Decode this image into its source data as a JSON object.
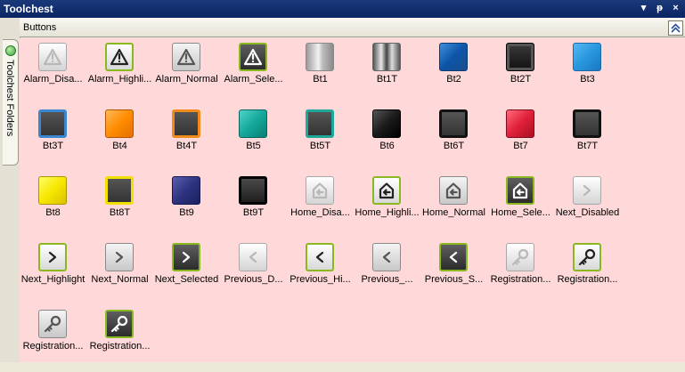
{
  "window": {
    "title": "Toolchest",
    "controls": [
      "▾",
      "ᵽ",
      "×"
    ]
  },
  "side_panel": {
    "label": "Toolchest Folders"
  },
  "section": {
    "title": "Buttons"
  },
  "items": [
    {
      "label": "Alarm_Disa...",
      "style": "gray-light",
      "glyph": "alarm",
      "glyph_color": "#b8b8b8"
    },
    {
      "label": "Alarm_Highli...",
      "style": "hl",
      "glyph": "alarm",
      "glyph_color": "#222222"
    },
    {
      "label": "Alarm_Normal",
      "style": "gray-dark",
      "glyph": "alarm",
      "glyph_color": "#555555"
    },
    {
      "label": "Alarm_Sele...",
      "style": "sel",
      "glyph": "alarm",
      "glyph_color": "#ffffff"
    },
    {
      "label": "Bt1",
      "style": "silver",
      "glyph": "none"
    },
    {
      "label": "Bt1T",
      "style": "tex",
      "glyph": "none"
    },
    {
      "label": "Bt2",
      "style": "blue",
      "glyph": "none"
    },
    {
      "label": "Bt2T",
      "style": "black",
      "glyph": "none"
    },
    {
      "label": "Bt3",
      "style": "lightblue",
      "glyph": "none"
    },
    {
      "label": "Bt3T",
      "style": "blue-t",
      "glyph": "none"
    },
    {
      "label": "Bt4",
      "style": "orange",
      "glyph": "none"
    },
    {
      "label": "Bt4T",
      "style": "orange-t",
      "glyph": "none"
    },
    {
      "label": "Bt5",
      "style": "teal",
      "glyph": "none"
    },
    {
      "label": "Bt5T",
      "style": "teal-t",
      "glyph": "none"
    },
    {
      "label": "Bt6",
      "style": "black2",
      "glyph": "none"
    },
    {
      "label": "Bt6T",
      "style": "black-t",
      "glyph": "none"
    },
    {
      "label": "Bt7",
      "style": "red",
      "glyph": "none"
    },
    {
      "label": "Bt7T",
      "style": "black-t",
      "glyph": "none"
    },
    {
      "label": "Bt8",
      "style": "yellow",
      "glyph": "none"
    },
    {
      "label": "Bt8T",
      "style": "yellow-t",
      "glyph": "none"
    },
    {
      "label": "Bt9",
      "style": "navy",
      "glyph": "none"
    },
    {
      "label": "Bt9T",
      "style": "black9t",
      "glyph": "none"
    },
    {
      "label": "Home_Disa...",
      "style": "gray-light",
      "glyph": "home",
      "glyph_color": "#b8b8b8"
    },
    {
      "label": "Home_Highli...",
      "style": "hl",
      "glyph": "home",
      "glyph_color": "#222222"
    },
    {
      "label": "Home_Normal",
      "style": "gray-dark",
      "glyph": "home",
      "glyph_color": "#555555"
    },
    {
      "label": "Home_Sele...",
      "style": "sel",
      "glyph": "home",
      "glyph_color": "#ffffff"
    },
    {
      "label": "Next_Disabled",
      "style": "gray-light",
      "glyph": "next",
      "glyph_color": "#b8b8b8"
    },
    {
      "label": "Next_Highlight",
      "style": "hl",
      "glyph": "next",
      "glyph_color": "#222222"
    },
    {
      "label": "Next_Normal",
      "style": "gray-dark",
      "glyph": "next",
      "glyph_color": "#555555"
    },
    {
      "label": "Next_Selected",
      "style": "sel",
      "glyph": "next",
      "glyph_color": "#ffffff"
    },
    {
      "label": "Previous_D...",
      "style": "gray-light",
      "glyph": "prev",
      "glyph_color": "#b8b8b8"
    },
    {
      "label": "Previous_Hi...",
      "style": "hl",
      "glyph": "prev",
      "glyph_color": "#222222"
    },
    {
      "label": "Previous_...",
      "style": "gray-dark",
      "glyph": "prev",
      "glyph_color": "#555555"
    },
    {
      "label": "Previous_S...",
      "style": "sel",
      "glyph": "prev",
      "glyph_color": "#ffffff"
    },
    {
      "label": "Registration...",
      "style": "gray-light",
      "glyph": "key",
      "glyph_color": "#b8b8b8"
    },
    {
      "label": "Registration...",
      "style": "hl",
      "glyph": "key",
      "glyph_color": "#222222"
    },
    {
      "label": "Registration...",
      "style": "gray-dark",
      "glyph": "key",
      "glyph_color": "#555555"
    },
    {
      "label": "Registration...",
      "style": "sel",
      "glyph": "key",
      "glyph_color": "#ffffff"
    }
  ]
}
